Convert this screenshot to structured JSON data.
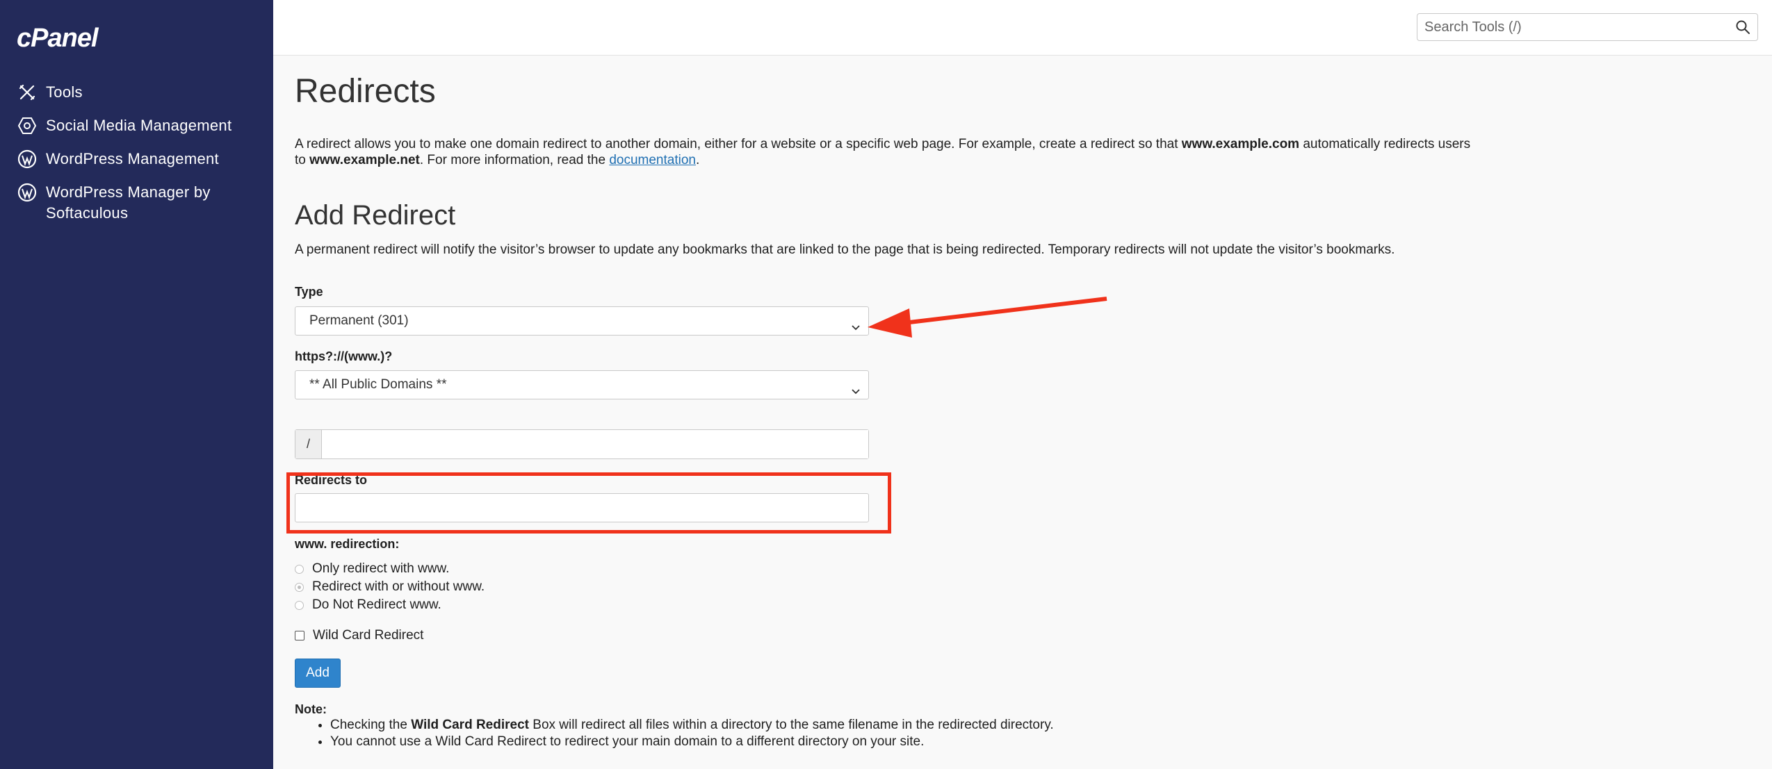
{
  "brand": {
    "logo_text": "cPanel"
  },
  "sidebar": {
    "items": [
      {
        "label": "Tools",
        "icon": "tools-icon"
      },
      {
        "label": "Social Media Management",
        "icon": "social-media-icon"
      },
      {
        "label": "WordPress Management",
        "icon": "wordpress-icon"
      },
      {
        "label": "WordPress Manager by\nSoftaculous",
        "icon": "wordpress-icon"
      }
    ]
  },
  "search": {
    "placeholder": "Search Tools (/)"
  },
  "page": {
    "title": "Redirects",
    "intro": {
      "part1": "A redirect allows you to make one domain redirect to another domain, either for a website or a specific web page. For example, create a redirect so that ",
      "bold1": "www.example.com",
      "part2": " automatically redirects users to ",
      "bold2": "www.example.net",
      "part3": ". For more information, read the ",
      "link": "documentation",
      "part4": "."
    }
  },
  "add_redirect": {
    "title": "Add Redirect",
    "description": "A permanent redirect will notify the visitor’s browser to update any bookmarks that are linked to the page that is being redirected. Temporary redirects will not update the visitor’s bookmarks.",
    "type_label": "Type",
    "type_value": "Permanent (301)",
    "domain_label": "https?://(www.)?",
    "domain_value": "** All Public Domains **",
    "path_prefix": "/",
    "path_value": "",
    "redirects_to_label": "Redirects to",
    "redirects_to_value": "",
    "www_label": "www. redirection:",
    "www_options": [
      {
        "label": "Only redirect with www.",
        "checked": false
      },
      {
        "label": "Redirect with or without www.",
        "checked": true
      },
      {
        "label": "Do Not Redirect www.",
        "checked": false
      }
    ],
    "wildcard_label": "Wild Card Redirect",
    "wildcard_checked": false,
    "add_button": "Add",
    "note_title": "Note:",
    "notes": {
      "n1_pre": "Checking the ",
      "n1_bold": "Wild Card Redirect",
      "n1_post": " Box will redirect all files within a directory to the same filename in the redirected directory.",
      "n2": "You cannot use a Wild Card Redirect to redirect your main domain to a different directory on your site."
    }
  },
  "colors": {
    "sidebar_bg": "#232a5a",
    "accent": "#2f84cc",
    "annotation": "#f0321b"
  }
}
